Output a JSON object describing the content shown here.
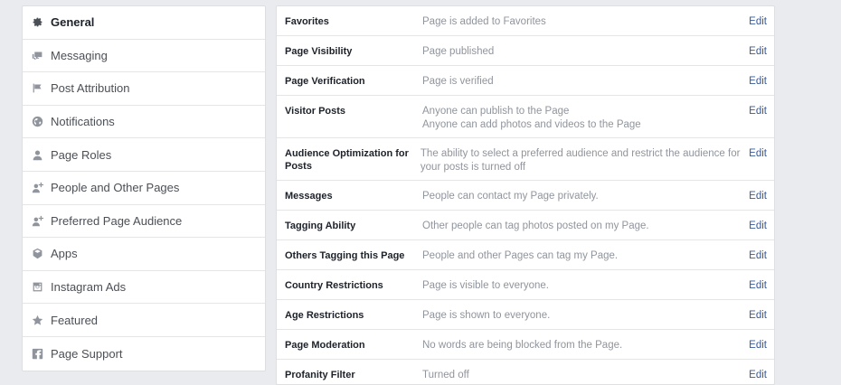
{
  "sidebar": {
    "items": [
      {
        "label": "General",
        "icon": "gear-icon",
        "active": true
      },
      {
        "label": "Messaging",
        "icon": "messaging-icon"
      },
      {
        "label": "Post Attribution",
        "icon": "flag-icon"
      },
      {
        "label": "Notifications",
        "icon": "globe-icon"
      },
      {
        "label": "Page Roles",
        "icon": "person-icon"
      },
      {
        "label": "People and Other Pages",
        "icon": "person-add-icon"
      },
      {
        "label": "Preferred Page Audience",
        "icon": "person-add-icon"
      },
      {
        "label": "Apps",
        "icon": "cube-icon"
      },
      {
        "label": "Instagram Ads",
        "icon": "instagram-icon"
      },
      {
        "label": "Featured",
        "icon": "star-icon"
      },
      {
        "label": "Page Support",
        "icon": "facebook-icon"
      }
    ]
  },
  "settings": {
    "edit_label": "Edit",
    "rows": [
      {
        "label": "Favorites",
        "values": [
          "Page is added to Favorites"
        ]
      },
      {
        "label": "Page Visibility",
        "values": [
          "Page published"
        ]
      },
      {
        "label": "Page Verification",
        "values": [
          "Page is verified"
        ]
      },
      {
        "label": "Visitor Posts",
        "values": [
          "Anyone can publish to the Page",
          "Anyone can add photos and videos to the Page"
        ]
      },
      {
        "label": "Audience Optimization for Posts",
        "values": [
          "The ability to select a preferred audience and restrict the audience for",
          "your posts is turned off"
        ]
      },
      {
        "label": "Messages",
        "values": [
          "People can contact my Page privately."
        ]
      },
      {
        "label": "Tagging Ability",
        "values": [
          "Other people can tag photos posted on my Page."
        ]
      },
      {
        "label": "Others Tagging this Page",
        "values": [
          "People and other Pages can tag my Page."
        ]
      },
      {
        "label": "Country Restrictions",
        "values": [
          "Page is visible to everyone."
        ]
      },
      {
        "label": "Age Restrictions",
        "values": [
          "Page is shown to everyone."
        ]
      },
      {
        "label": "Page Moderation",
        "values": [
          "No words are being blocked from the Page."
        ]
      },
      {
        "label": "Profanity Filter",
        "values": [
          "Turned off"
        ]
      }
    ]
  }
}
